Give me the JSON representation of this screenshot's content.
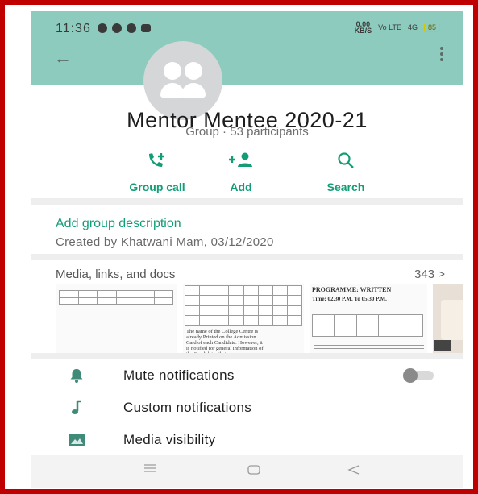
{
  "status_bar": {
    "time": "11:36",
    "network_speed": "0.00\nKB/S",
    "signal_label": "Vo LTE",
    "network": "4G",
    "battery": "85"
  },
  "group": {
    "name": "Mentor Mentee 2020-21",
    "subtitle": "Group · 53 participants"
  },
  "actions": [
    {
      "label": "Group call",
      "icon": "add-call-icon"
    },
    {
      "label": "Add",
      "icon": "add-person-icon"
    },
    {
      "label": "Search",
      "icon": "search-icon"
    }
  ],
  "description": {
    "add_label": "Add group description",
    "created": "Created by Khatwani Mam, 03/12/2020"
  },
  "media": {
    "title": "Media, links, and docs",
    "count": "343 >",
    "thumb2_text": "The name of the College Centre is already Printed on the Admission Card of each Candidate. However, it is notified for general information of the Candidates that :-",
    "thumb3_heading": "PROGRAMME: WRITTEN",
    "thumb3_time": "Time: 02.30 P.M. To 05.30 P.M."
  },
  "settings": [
    {
      "label": "Mute notifications",
      "icon": "bell-icon"
    },
    {
      "label": "Custom notifications",
      "icon": "music-note-icon"
    },
    {
      "label": "Media visibility",
      "icon": "image-icon"
    }
  ],
  "mute_toggle": {
    "on": false
  },
  "colors": {
    "header": "#8ccbbd",
    "accent": "#139d76",
    "border": "#c00000"
  }
}
